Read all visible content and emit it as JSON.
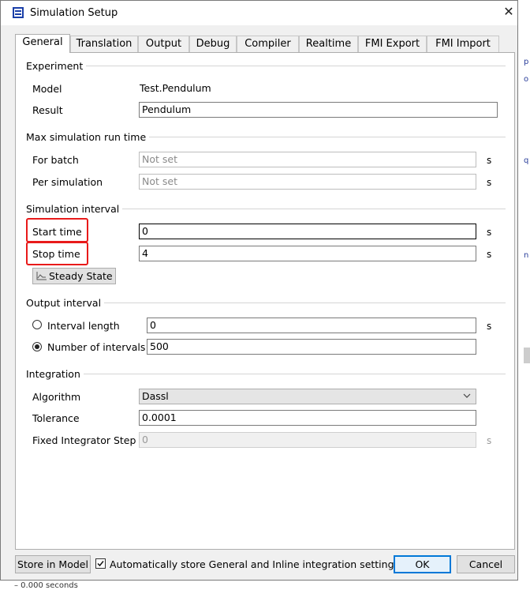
{
  "window": {
    "title": "Simulation Setup",
    "close_glyph": "✕"
  },
  "tabs": [
    {
      "label": "General",
      "active": true
    },
    {
      "label": "Translation"
    },
    {
      "label": "Output"
    },
    {
      "label": "Debug"
    },
    {
      "label": "Compiler"
    },
    {
      "label": "Realtime"
    },
    {
      "label": "FMI Export"
    },
    {
      "label": "FMI Import"
    }
  ],
  "experiment": {
    "title": "Experiment",
    "model_label": "Model",
    "model_value": "Test.Pendulum",
    "result_label": "Result",
    "result_value": "Pendulum"
  },
  "max_run_time": {
    "title": "Max simulation run time",
    "for_batch_label": "For batch",
    "for_batch_placeholder": "Not set",
    "per_sim_label": "Per simulation",
    "per_sim_placeholder": "Not set",
    "unit": "s"
  },
  "sim_interval": {
    "title": "Simulation interval",
    "start_label": "Start time",
    "start_value": "0",
    "stop_label": "Stop time",
    "stop_value": "4",
    "unit": "s",
    "steady_state_label": "Steady State"
  },
  "output_interval": {
    "title": "Output interval",
    "interval_length_label": "Interval length",
    "interval_length_value": "0",
    "num_intervals_label": "Number of intervals",
    "num_intervals_value": "500",
    "selected": "num_intervals",
    "unit": "s"
  },
  "integration": {
    "title": "Integration",
    "algorithm_label": "Algorithm",
    "algorithm_value": "Dassl",
    "tolerance_label": "Tolerance",
    "tolerance_value": "0.0001",
    "fixed_step_label": "Fixed Integrator Step",
    "fixed_step_value": "0",
    "unit": "s"
  },
  "footer": {
    "store_label": "Store in Model",
    "auto_store_label": "Automatically store General and Inline integration settings",
    "auto_store_checked": true,
    "ok_label": "OK",
    "cancel_label": "Cancel"
  },
  "colors": {
    "highlight": "#e81a1a",
    "accent": "#0078d7"
  }
}
